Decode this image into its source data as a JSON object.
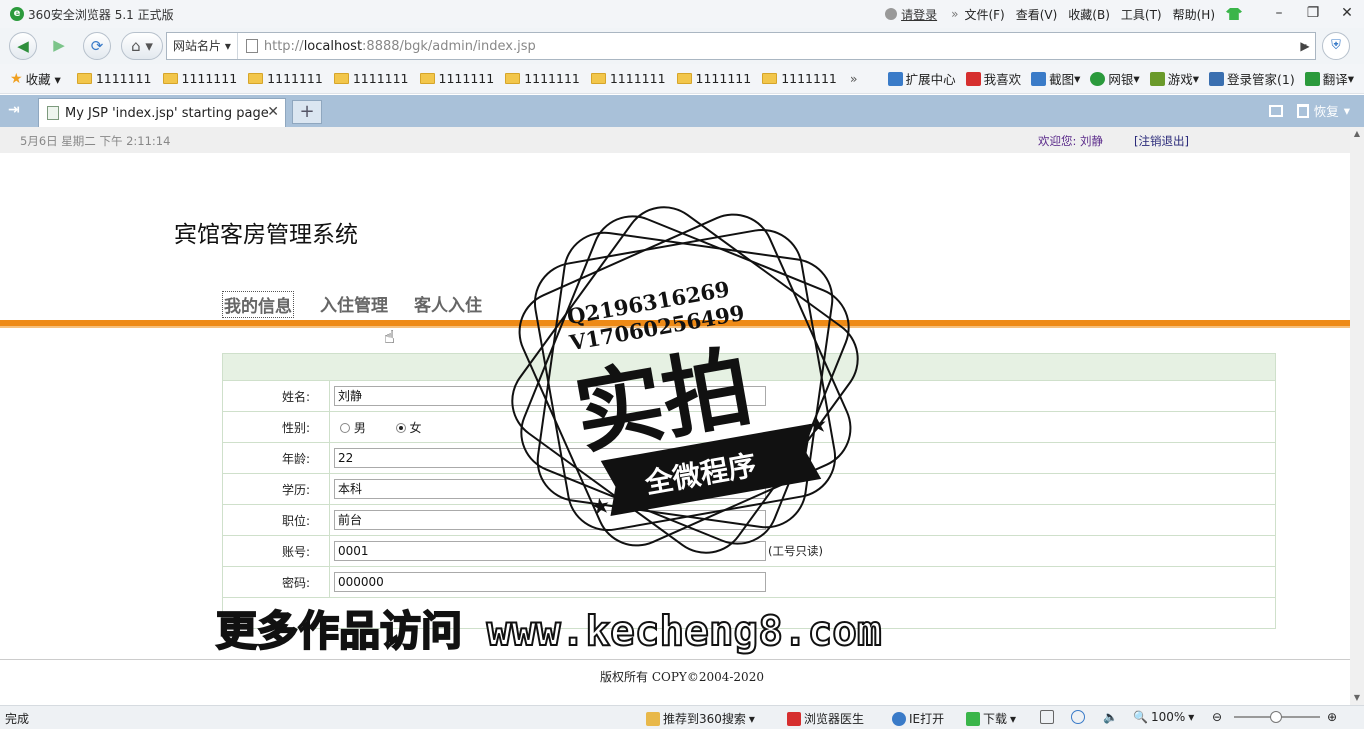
{
  "titlebar": {
    "title": "360安全浏览器 5.1 正式版",
    "login": "请登录",
    "menus": [
      "文件(F)",
      "查看(V)",
      "收藏(B)",
      "工具(T)",
      "帮助(H)"
    ],
    "min": "–",
    "restore": "❐",
    "close": "✕"
  },
  "navbar": {
    "site_cards": "网站名片",
    "url_prefix": "http://",
    "url_host": "localhost",
    "url_rest": ":8888/bgk/admin/index.jsp"
  },
  "bookmarks": {
    "favorites": "收藏",
    "folders": [
      "1111111",
      "1111111",
      "1111111",
      "1111111",
      "1111111",
      "1111111",
      "1111111",
      "1111111",
      "1111111"
    ],
    "more": "»",
    "extensions": [
      {
        "label": "扩展中心",
        "color": "#3a7bc8"
      },
      {
        "label": "我喜欢",
        "color": "#d62f2f"
      },
      {
        "label": "截图",
        "color": "#3a7bc8"
      },
      {
        "label": "网银",
        "color": "#2b9a3c"
      },
      {
        "label": "游戏",
        "color": "#6a9a2b"
      },
      {
        "label": "登录管家(1)",
        "color": "#3a6fb0"
      },
      {
        "label": "翻译",
        "color": "#2b9a3c"
      }
    ]
  },
  "tabs": {
    "active_label": "My JSP 'index.jsp' starting page",
    "close": "✕",
    "new": "+",
    "restore": "恢复"
  },
  "page": {
    "date": "5月6日 星期二 下午 2:11:14",
    "welcome": "欢迎您: 刘静",
    "logout": "[注销退出]",
    "system_title": "宾馆客房管理系统",
    "menu": [
      "我的信息",
      "入住管理",
      "客人入住"
    ],
    "form": {
      "name_label": "姓名:",
      "name_value": "刘静",
      "gender_label": "性别:",
      "gender_male": "男",
      "gender_female": "女",
      "age_label": "年龄:",
      "age_value": "22",
      "edu_label": "学历:",
      "edu_value": "本科",
      "job_label": "职位:",
      "job_value": "前台",
      "account_label": "账号:",
      "account_value": "0001",
      "account_note": "(工号只读)",
      "password_label": "密码:",
      "password_value": "000000"
    },
    "copyright": "版权所有 COPY©2004-2020"
  },
  "overlay": {
    "stamp_qq": "Q2196316269",
    "stamp_v": "V17060256499",
    "stamp_main": "实拍",
    "stamp_ribbon": "全微程序",
    "watermark": "更多作品访问 www.kecheng8.com"
  },
  "statusbar": {
    "status": "完成",
    "recommend": "推荐到360搜索",
    "doctor": "浏览器医生",
    "ie_open": "IE打开",
    "download": "下载",
    "zoom": "100%"
  }
}
